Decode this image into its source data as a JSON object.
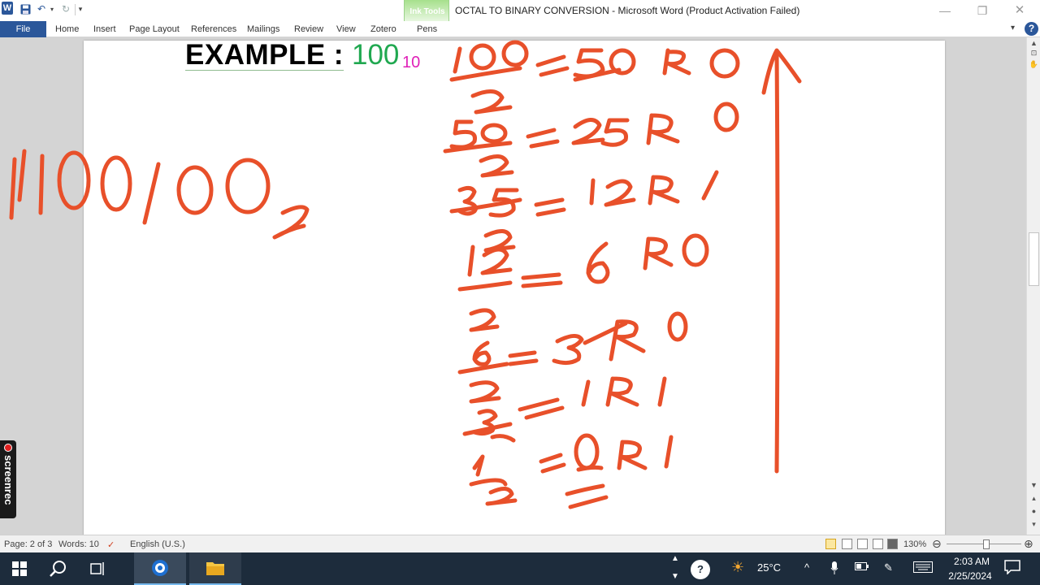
{
  "window": {
    "title": "OCTAL TO BINARY CONVERSION  -  Microsoft Word (Product Activation Failed)",
    "contextual_group": "Ink Tools",
    "controls": {
      "minimize": "—",
      "restore": "❐",
      "close": "✕"
    }
  },
  "quick_access": {
    "logo": "W",
    "save": "💾",
    "undo": "↶",
    "redo": "↻",
    "dropdown": "▾",
    "customize": "▾"
  },
  "ribbon": {
    "file": "File",
    "tabs": [
      "Home",
      "Insert",
      "Page Layout",
      "References",
      "Mailings",
      "Review",
      "View",
      "Zotero",
      "Pens"
    ],
    "collapse": "▾",
    "help": "?"
  },
  "document": {
    "example_label": "EXAMPLE :",
    "example_value": "100",
    "example_base": "10",
    "handwritten": {
      "result": "1100100",
      "divisions": [
        {
          "dividend": "100",
          "divisor": "2",
          "quotient": "50",
          "remainder": "R 0"
        },
        {
          "dividend": "50",
          "divisor": "2",
          "quotient": "25",
          "remainder": "R 0"
        },
        {
          "dividend": "25",
          "divisor": "2",
          "quotient": "12",
          "remainder": "R 1"
        },
        {
          "dividend": "12",
          "divisor": "2",
          "quotient": "6",
          "remainder": "R 0"
        },
        {
          "dividend": "6",
          "divisor": "2",
          "quotient": "3",
          "remainder": "R 0"
        },
        {
          "dividend": "3",
          "divisor": "2",
          "quotient": "1",
          "remainder": "R 1"
        },
        {
          "dividend": "1",
          "divisor": "2",
          "quotient": "0",
          "remainder": "R 1"
        }
      ],
      "ink_color": "#e8502a"
    }
  },
  "statusbar": {
    "page": "Page: 2 of 3",
    "words": "Words: 10",
    "language": "English (U.S.)",
    "zoom": "130%",
    "zoom_level": 130
  },
  "taskbar": {
    "weather": "25°C",
    "time": "2:03 AM",
    "date": "2/25/2024"
  },
  "watermark": {
    "text": "screenrec"
  },
  "colors": {
    "word_blue": "#2b579a",
    "ink_tools_green": "#a6e08c",
    "example_green": "#20a850",
    "subscript_magenta": "#e020b8"
  }
}
